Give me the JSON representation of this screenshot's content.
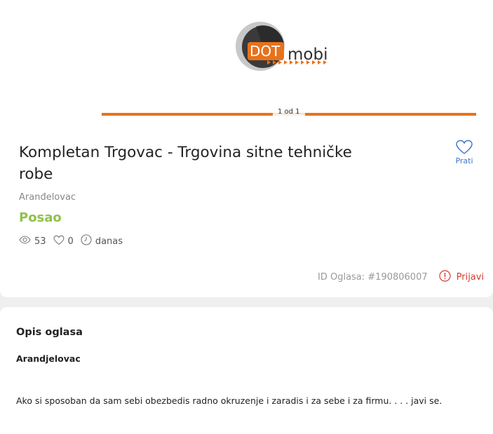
{
  "gallery": {
    "logo_text_dot": "DOT",
    "logo_text_mobi": "mobi",
    "counter": "1 od 1"
  },
  "listing": {
    "title": "Kompletan Trgovac - Trgovina sitne tehničke robe",
    "location": "Aranđelovac",
    "category": "Posao",
    "views": "53",
    "favorites": "0",
    "posted": "danas",
    "ad_id": "ID Oglasa: #190806007",
    "report_label": "Prijavi",
    "follow_label": "Prati"
  },
  "description": {
    "heading": "Opis oglasa",
    "subheading": "Arandjelovac",
    "text": "Ako si sposoban da sam sebi obezbedis radno okruzenje i zaradis i za sebe i za firmu. . . . javi se."
  },
  "colors": {
    "accent_orange": "#e8721c",
    "category_green": "#8fc24a",
    "link_blue": "#3c76c7",
    "report_red": "#d63b2f"
  },
  "icons": [
    "heart-icon",
    "eye-icon",
    "clock-icon",
    "alert-icon"
  ]
}
